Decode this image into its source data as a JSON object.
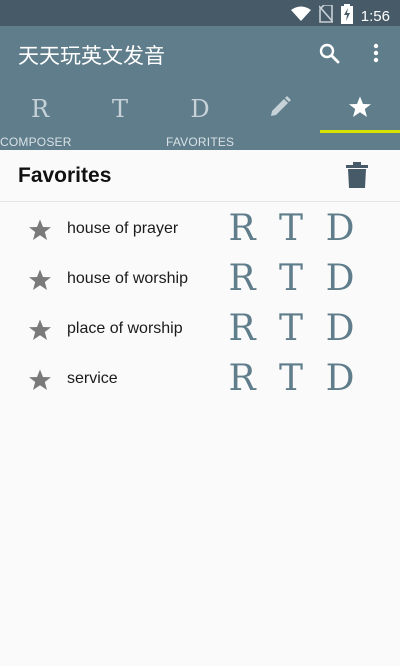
{
  "status_bar": {
    "time": "1:56"
  },
  "app": {
    "title": "天天玩英文发音"
  },
  "tabs": [
    {
      "glyph": "R",
      "icon": "r-glyph"
    },
    {
      "glyph": "T",
      "icon": "t-glyph"
    },
    {
      "glyph": "D",
      "icon": "d-glyph"
    },
    {
      "icon": "pencil-icon"
    },
    {
      "icon": "star-icon",
      "selected": true
    }
  ],
  "tab_labels": {
    "composer": "COMPOSER",
    "favorites": "FAVORITES"
  },
  "section": {
    "title": "Favorites"
  },
  "favorites": [
    {
      "text": "house of prayer",
      "r": "R",
      "t": "T",
      "d": "D"
    },
    {
      "text": "house of worship",
      "r": "R",
      "t": "T",
      "d": "D"
    },
    {
      "text": "place of worship",
      "r": "R",
      "t": "T",
      "d": "D"
    },
    {
      "text": "service",
      "r": "R",
      "t": "T",
      "d": "D"
    }
  ],
  "colors": {
    "status_bar": "#465a68",
    "app_bar": "#607d8b",
    "tab_indicator": "#d6e200",
    "letter_buttons": "#607d8b",
    "star": "#7a7a7a"
  }
}
